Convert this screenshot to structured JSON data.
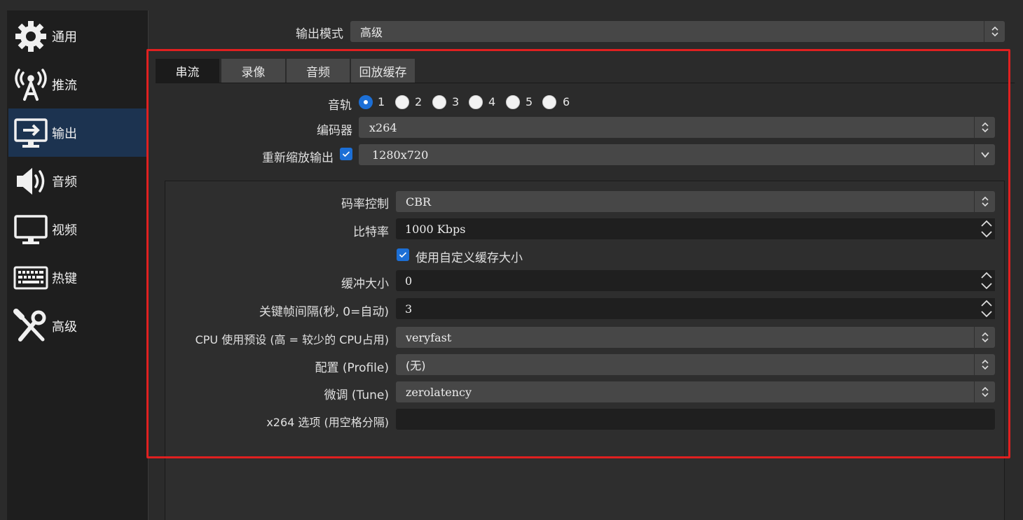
{
  "sidebar": {
    "items": [
      {
        "label": "通用",
        "icon": "gear-icon",
        "active": false
      },
      {
        "label": "推流",
        "icon": "broadcast-icon",
        "active": false
      },
      {
        "label": "输出",
        "icon": "output-icon",
        "active": true
      },
      {
        "label": "音频",
        "icon": "speaker-icon",
        "active": false
      },
      {
        "label": "视频",
        "icon": "monitor-icon",
        "active": false
      },
      {
        "label": "热键",
        "icon": "keyboard-icon",
        "active": false
      },
      {
        "label": "高级",
        "icon": "tools-icon",
        "active": false
      }
    ]
  },
  "output_mode": {
    "label": "输出模式",
    "value": "高级"
  },
  "tabs": [
    {
      "label": "串流",
      "active": true
    },
    {
      "label": "录像",
      "active": false
    },
    {
      "label": "音频",
      "active": false
    },
    {
      "label": "回放缓存",
      "active": false
    }
  ],
  "stream": {
    "track": {
      "label": "音轨",
      "options": [
        "1",
        "2",
        "3",
        "4",
        "5",
        "6"
      ],
      "selected": "1"
    },
    "encoder": {
      "label": "编码器",
      "value": "x264"
    },
    "rescale": {
      "label": "重新缩放输出",
      "checked": true,
      "value": "1280x720"
    },
    "rate_control": {
      "label": "码率控制",
      "value": "CBR"
    },
    "bitrate": {
      "label": "比特率",
      "value": "1000 Kbps"
    },
    "custom_buffer": {
      "label": "使用自定义缓存大小",
      "checked": true
    },
    "buffer_size": {
      "label": "缓冲大小",
      "value": "0"
    },
    "keyframe": {
      "label": "关键帧间隔(秒, 0=自动)",
      "value": "3"
    },
    "cpu_preset": {
      "label": "CPU 使用预设 (高 = 较少的 CPU占用)",
      "value": "veryfast"
    },
    "profile": {
      "label": "配置 (Profile)",
      "value": "(无)"
    },
    "tune": {
      "label": "微调 (Tune)",
      "value": "zerolatency"
    },
    "x264_opts": {
      "label": "x264 选项 (用空格分隔)",
      "value": ""
    }
  },
  "colors": {
    "accent": "#1c6fd6",
    "highlight": "#e02020",
    "active_sidebar": "#1c3350"
  }
}
